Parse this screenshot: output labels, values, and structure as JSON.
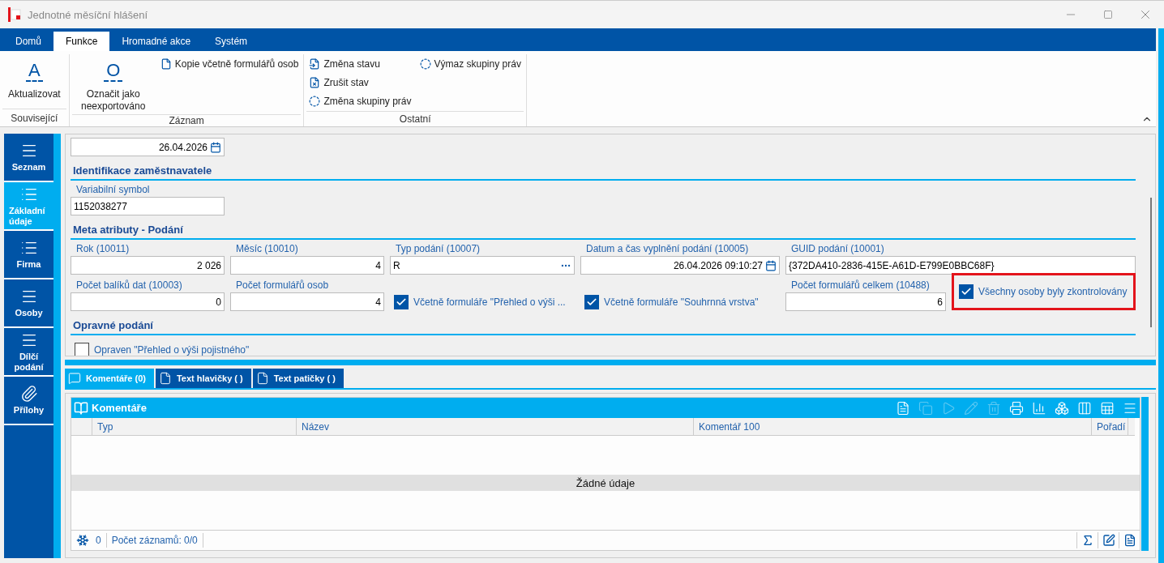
{
  "window": {
    "title": "Jednotné měsíční hlášení"
  },
  "ribbon": {
    "tabs": [
      {
        "label": "Domů",
        "selected": false
      },
      {
        "label": "Funkce",
        "selected": true
      },
      {
        "label": "Hromadné akce",
        "selected": false
      },
      {
        "label": "Systém",
        "selected": false
      }
    ],
    "groups": [
      {
        "label": "Související",
        "buttons": [
          {
            "kind": "large",
            "glyph": "A",
            "label": "Aktualizovat"
          }
        ]
      },
      {
        "label": "Záznam",
        "buttons": [
          {
            "kind": "large",
            "glyph": "O",
            "label": "Označit jako neexportováno"
          },
          {
            "kind": "small",
            "label": "Kopie včetně formulářů osob"
          }
        ]
      },
      {
        "label": "Ostatní",
        "buttons": [
          {
            "kind": "small",
            "label": "Změna stavu"
          },
          {
            "kind": "small",
            "label": "Zrušit stav"
          },
          {
            "kind": "small",
            "label": "Změna skupiny práv"
          },
          {
            "kind": "small",
            "label": "Výmaz skupiny práv"
          }
        ]
      }
    ]
  },
  "nav": [
    {
      "label": "Seznam",
      "selected": false
    },
    {
      "label": "Základní údaje",
      "selected": true
    },
    {
      "label": "Firma",
      "selected": false
    },
    {
      "label": "Osoby",
      "selected": false
    },
    {
      "label": "Dílčí podání",
      "selected": false
    },
    {
      "label": "Přílohy",
      "selected": false
    }
  ],
  "form": {
    "top_field": {
      "kind": "date",
      "value": "26.04.2026"
    },
    "sections": [
      {
        "heading": "Identifikace zaměstnavatele",
        "rows": [
          [
            {
              "kind": "text",
              "label": "Variabilní symbol",
              "value": "1152038277"
            }
          ]
        ]
      },
      {
        "heading": "Meta atributy - Podání",
        "rows": [
          [
            {
              "kind": "number",
              "label": "Rok (10011)",
              "value": "2 026"
            },
            {
              "kind": "number",
              "label": "Měsíc (10010)",
              "value": "4"
            },
            {
              "kind": "lookup",
              "label": "Typ podání (10007)",
              "value": "R"
            },
            {
              "kind": "date",
              "label": "Datum a čas vyplnění podání (10005)",
              "value": "26.04.2026 09:10:27"
            },
            {
              "kind": "text",
              "label": "GUID podání (10001)",
              "value": "{372DA410-2836-415E-A61D-E799E0BBC68F}"
            }
          ],
          [
            {
              "kind": "number",
              "label": "Počet balíků dat (10003)",
              "value": "0"
            },
            {
              "kind": "number",
              "label": "Počet formulářů osob",
              "value": "4"
            },
            {
              "kind": "checkbox",
              "label": "Včetně formuláře \"Přehled o výši ...",
              "checked": true,
              "highlighted": false
            },
            {
              "kind": "checkbox",
              "label": "Včetně formuláře \"Souhrnná vrstva\"",
              "checked": true,
              "highlighted": false
            },
            {
              "kind": "number",
              "label": "Počet formulářů celkem (10488)",
              "value": "6"
            },
            {
              "kind": "checkbox",
              "label": "Všechny osoby byly zkontrolovány",
              "checked": true,
              "highlighted": true
            }
          ]
        ]
      },
      {
        "heading": "Opravné podání",
        "rows": [
          [
            {
              "kind": "checkbox",
              "label": "Opraven \"Přehled o výši pojistného\"",
              "checked": false,
              "highlighted": false
            }
          ]
        ]
      }
    ]
  },
  "bottom_tabs": [
    {
      "label": "Komentáře (0)",
      "selected": true
    },
    {
      "label": "Text hlavičky ( )",
      "selected": false
    },
    {
      "label": "Text patičky ( )",
      "selected": false
    }
  ],
  "grid": {
    "title": "Komentáře",
    "toolbar": [
      {
        "disabled": false
      },
      {
        "disabled": true
      },
      {
        "disabled": true
      },
      {
        "disabled": true
      },
      {
        "disabled": true
      },
      {
        "disabled": false
      },
      {
        "disabled": false
      },
      {
        "disabled": false
      },
      {
        "disabled": false
      },
      {
        "disabled": false
      },
      {
        "disabled": false
      }
    ],
    "columns": [
      "Typ",
      "Název",
      "Komentář 100",
      "Pořadí"
    ],
    "empty_text": "Žádné údaje",
    "footer": {
      "count": "0",
      "records": "Počet záznamů: 0/0"
    }
  }
}
